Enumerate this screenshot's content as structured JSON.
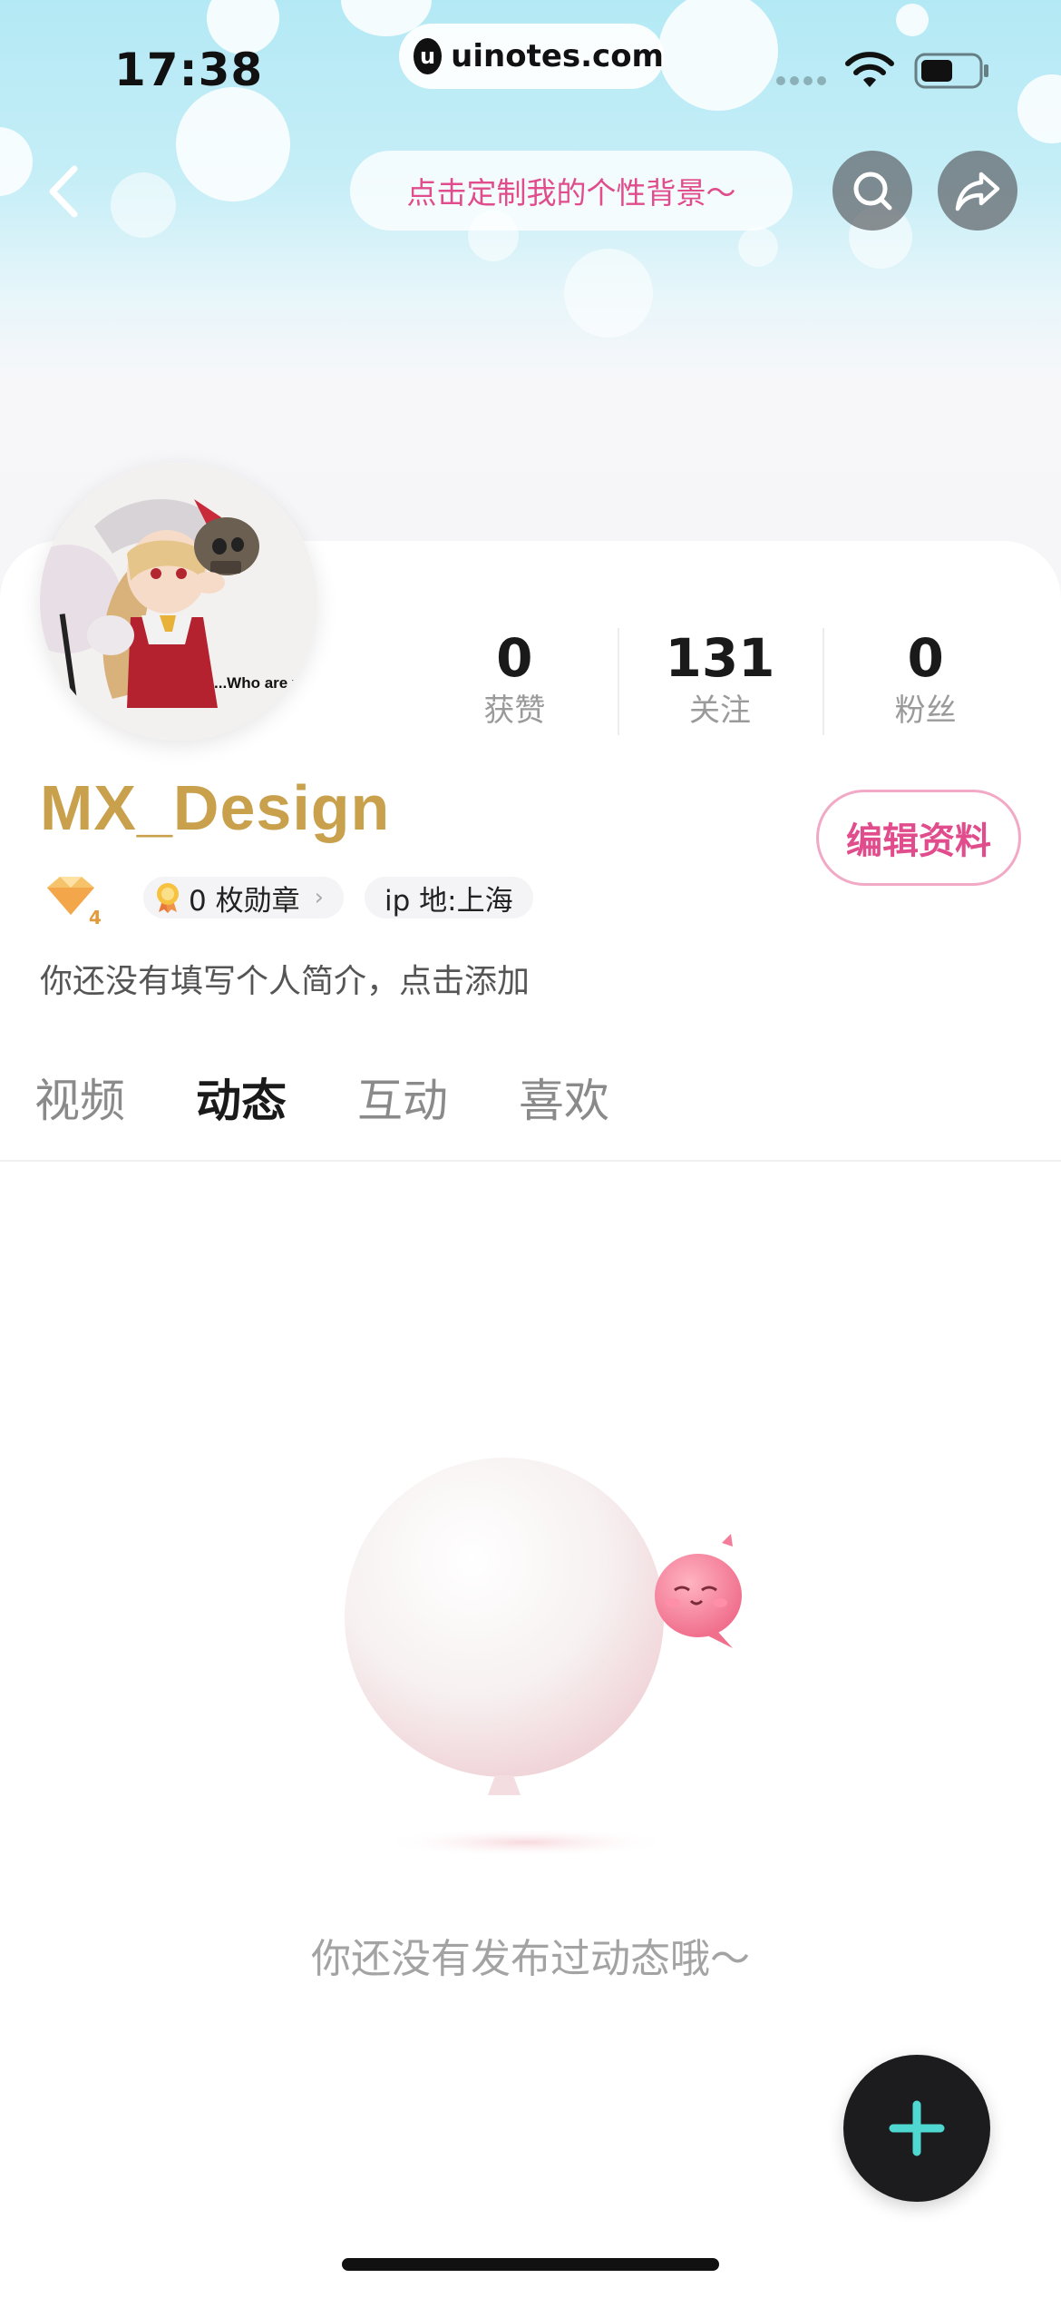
{
  "status_bar": {
    "time": "17:38",
    "url": "uinotes.com",
    "url_logo_letter": "u"
  },
  "header": {
    "customize_label": "点击定制我的个性背景～",
    "back_icon": "chevron-left-icon",
    "search_icon": "search-icon",
    "share_icon": "share-icon"
  },
  "avatar": {
    "caption": "...Who are y"
  },
  "stats": [
    {
      "value": "0",
      "label": "获赞"
    },
    {
      "value": "131",
      "label": "关注"
    },
    {
      "value": "0",
      "label": "粉丝"
    }
  ],
  "profile": {
    "username": "MX_Design",
    "edit_label": "编辑资料",
    "level": "4",
    "badges_label": "0 枚勋章",
    "ip_label": "ip 地:上海",
    "bio": "你还没有填写个人简介，点击添加"
  },
  "tabs": [
    {
      "label": "视频",
      "active": false
    },
    {
      "label": "动态",
      "active": true
    },
    {
      "label": "互动",
      "active": false
    },
    {
      "label": "喜欢",
      "active": false
    }
  ],
  "empty_state": {
    "message": "你还没有发布过动态哦～"
  },
  "fab": {
    "icon": "plus-icon"
  },
  "colors": {
    "accent_pink": "#e04c8c",
    "username_gold": "#c9a04b",
    "fab_plus": "#4fd8d2"
  }
}
